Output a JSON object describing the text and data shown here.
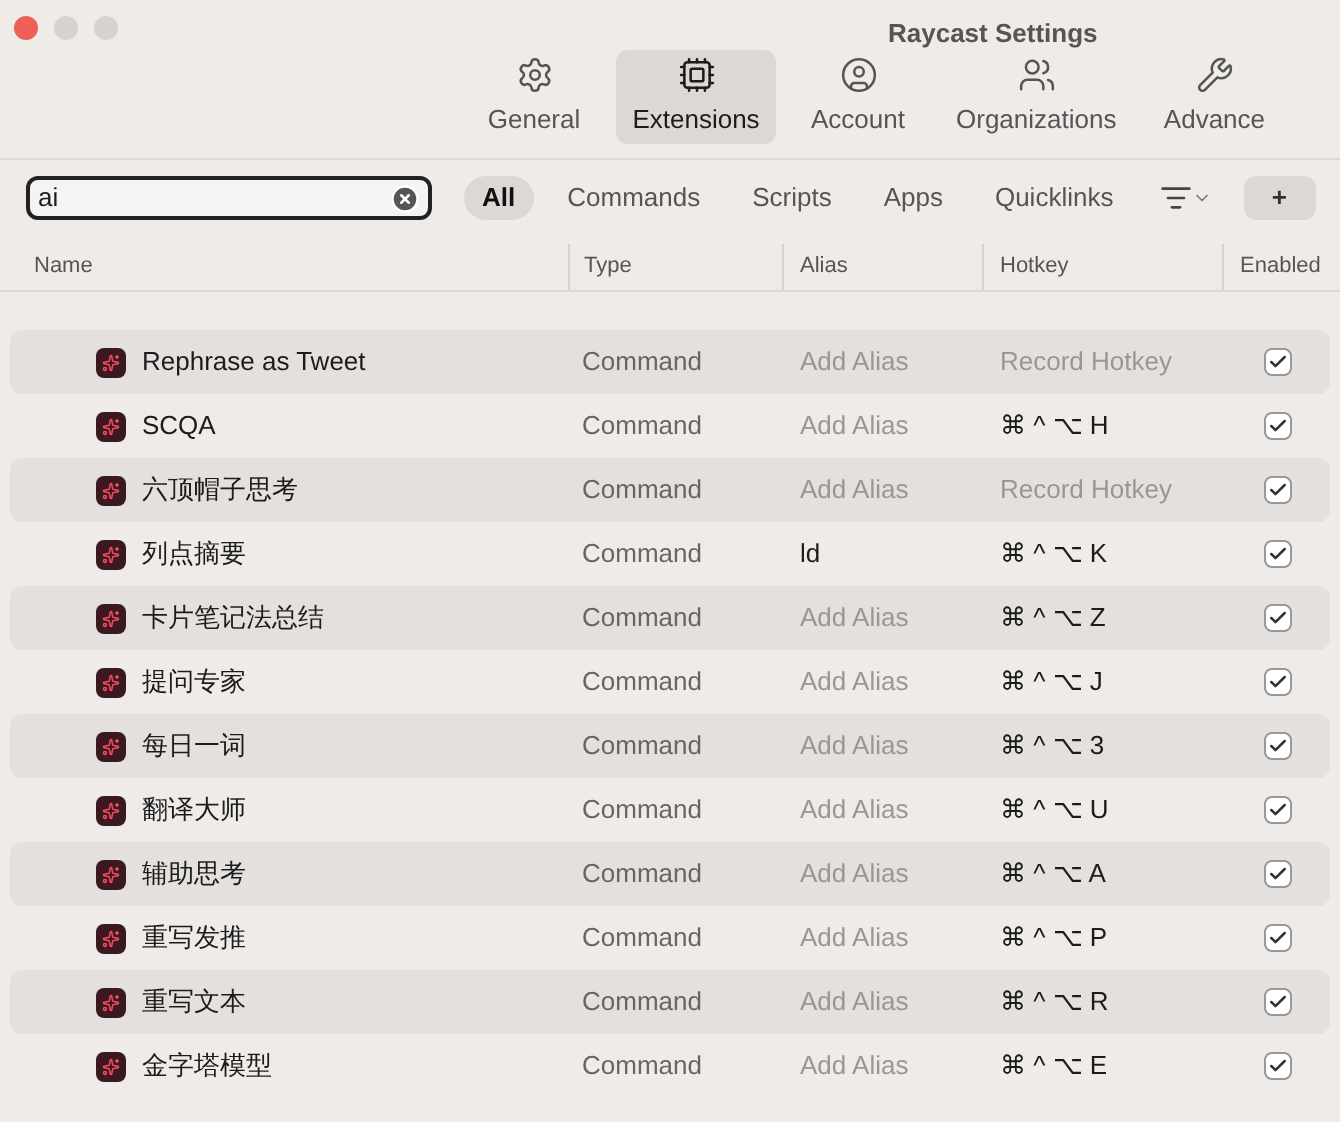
{
  "window": {
    "title": "Raycast Settings"
  },
  "tabs": [
    {
      "label": "General",
      "selected": false
    },
    {
      "label": "Extensions",
      "selected": true
    },
    {
      "label": "Account",
      "selected": false
    },
    {
      "label": "Organizations",
      "selected": false
    },
    {
      "label": "Advance",
      "selected": false
    }
  ],
  "search": {
    "value": "ai"
  },
  "filters": [
    {
      "label": "All",
      "selected": true
    },
    {
      "label": "Commands",
      "selected": false
    },
    {
      "label": "Scripts",
      "selected": false
    },
    {
      "label": "Apps",
      "selected": false
    },
    {
      "label": "Quicklinks",
      "selected": false
    }
  ],
  "add_button": {
    "label": "+"
  },
  "table": {
    "columns": [
      "Name",
      "Type",
      "Alias",
      "Hotkey",
      "Enabled"
    ],
    "rows": [
      {
        "name": "Rephrase as Tweet",
        "type": "Command",
        "alias": {
          "placeholder": "Add Alias"
        },
        "hotkey": {
          "placeholder": "Record Hotkey"
        },
        "enabled": true
      },
      {
        "name": "SCQA",
        "type": "Command",
        "alias": {
          "placeholder": "Add Alias"
        },
        "hotkey": {
          "value": "⌘ ^ ⌥ H"
        },
        "enabled": true
      },
      {
        "name": "六顶帽子思考",
        "type": "Command",
        "alias": {
          "placeholder": "Add Alias"
        },
        "hotkey": {
          "placeholder": "Record Hotkey"
        },
        "enabled": true
      },
      {
        "name": "列点摘要",
        "type": "Command",
        "alias": {
          "value": "ld"
        },
        "hotkey": {
          "value": "⌘ ^ ⌥ K"
        },
        "enabled": true
      },
      {
        "name": "卡片笔记法总结",
        "type": "Command",
        "alias": {
          "placeholder": "Add Alias"
        },
        "hotkey": {
          "value": "⌘ ^ ⌥ Z"
        },
        "enabled": true
      },
      {
        "name": "提问专家",
        "type": "Command",
        "alias": {
          "placeholder": "Add Alias"
        },
        "hotkey": {
          "value": "⌘ ^ ⌥ J"
        },
        "enabled": true
      },
      {
        "name": "每日一词",
        "type": "Command",
        "alias": {
          "placeholder": "Add Alias"
        },
        "hotkey": {
          "value": "⌘ ^ ⌥ 3"
        },
        "enabled": true
      },
      {
        "name": "翻译大师",
        "type": "Command",
        "alias": {
          "placeholder": "Add Alias"
        },
        "hotkey": {
          "value": "⌘ ^ ⌥ U"
        },
        "enabled": true
      },
      {
        "name": "辅助思考",
        "type": "Command",
        "alias": {
          "placeholder": "Add Alias"
        },
        "hotkey": {
          "value": "⌘ ^ ⌥ A"
        },
        "enabled": true
      },
      {
        "name": "重写发推",
        "type": "Command",
        "alias": {
          "placeholder": "Add Alias"
        },
        "hotkey": {
          "value": "⌘ ^ ⌥ P"
        },
        "enabled": true
      },
      {
        "name": "重写文本",
        "type": "Command",
        "alias": {
          "placeholder": "Add Alias"
        },
        "hotkey": {
          "value": "⌘ ^ ⌥ R"
        },
        "enabled": true
      },
      {
        "name": "金字塔模型",
        "type": "Command",
        "alias": {
          "placeholder": "Add Alias"
        },
        "hotkey": {
          "value": "⌘ ^ ⌥ E"
        },
        "enabled": true
      }
    ]
  }
}
